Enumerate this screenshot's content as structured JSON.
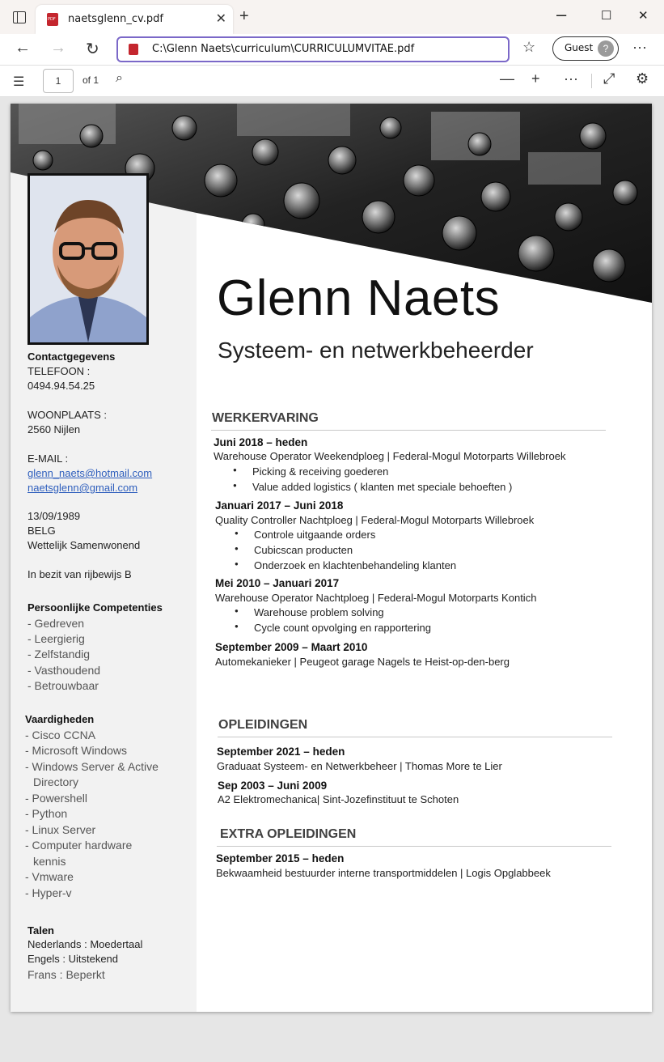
{
  "browser": {
    "tab_title": "naetsglenn_cv.pdf",
    "url": "C:\\Glenn Naets\\curriculum\\CURRICULUMVITAE.pdf",
    "profile_label": "Guest"
  },
  "pdf_toolbar": {
    "page_number": "1",
    "page_count": "of 1"
  },
  "cv": {
    "name": "Glenn Naets",
    "subtitle": "Systeem- en netwerkbeheerder",
    "contact": {
      "heading": "Contactgegevens",
      "phone_label": "TELEFOON :",
      "phone": "0494.94.54.25",
      "place_label": "WOONPLAATS :",
      "place": "2560 Nijlen",
      "email_label": "E-MAIL :",
      "email1": "glenn_naets@hotmail.com",
      "email2": "naetsglenn@gmail.com",
      "birthdate": "13/09/1989",
      "nationality": "BELG",
      "status": "Wettelijk Samenwonend",
      "license": "In bezit van rijbewijs B"
    },
    "competencies": {
      "heading": "Persoonlijke Competenties",
      "items": [
        "- Gedreven",
        "- Leergierig",
        "- Zelfstandig",
        "- Vasthoudend",
        "- Betrouwbaar"
      ]
    },
    "skills": {
      "heading": "Vaardigheden",
      "items": [
        "- Cisco CCNA",
        "- Microsoft Windows",
        "- Windows Server & Active",
        "Directory",
        "- Powershell",
        "- Python",
        "- Linux Server",
        "- Computer hardware",
        "kennis",
        "- Vmware",
        "- Hyper-v"
      ]
    },
    "languages": {
      "heading": "Talen",
      "items": [
        "Nederlands : Moedertaal",
        "Engels : Uitstekend",
        "Frans : Beperkt"
      ]
    },
    "work": {
      "heading": "WERKERVARING",
      "jobs": [
        {
          "period": "Juni  2018 – heden",
          "title": "Warehouse  Operator Weekendploeg | Federal-Mogul Motorparts Willebroek",
          "bullets": [
            "Picking & receiving goederen",
            "Value added logistics ( klanten met speciale behoeften )"
          ]
        },
        {
          "period": "Januari  2017 – Juni 2018",
          "title": "Quality Controller Nachtploeg | Federal-Mogul Motorparts Willebroek",
          "bullets": [
            "Controle uitgaande orders",
            "Cubicscan producten",
            "Onderzoek en klachtenbehandeling klanten"
          ]
        },
        {
          "period": "Mei 2010 – Januari  2017",
          "title": "Warehouse Operator Nachtploeg | Federal-Mogul Motorparts Kontich",
          "bullets": [
            "Warehouse problem solving",
            "Cycle count opvolging en rapportering"
          ]
        },
        {
          "period": "September 2009 – Maart  2010",
          "title": "Automekanieker | Peugeot garage Nagels te Heist-op-den-berg",
          "bullets": []
        }
      ]
    },
    "education": {
      "heading": "OPLEIDINGEN",
      "items": [
        {
          "period": "September 2021 – heden",
          "title": "Graduaat Systeem- en Netwerkbeheer | Thomas More  te  Lier"
        },
        {
          "period": "Sep 2003 – Juni 2009",
          "title": "A2 Elektromechanica| Sint-Jozefinstituut te Schoten"
        }
      ]
    },
    "extra": {
      "heading": "EXTRA OPLEIDINGEN",
      "items": [
        {
          "period": "September 2015 – heden",
          "title": "Bekwaamheid bestuurder interne transportmiddelen | Logis Opglabbeek"
        }
      ]
    }
  }
}
